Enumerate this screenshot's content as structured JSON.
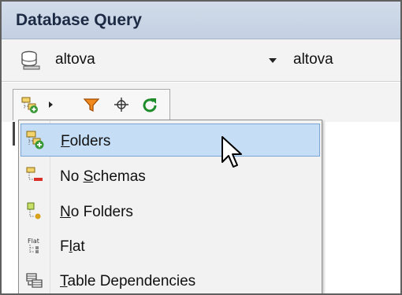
{
  "window": {
    "title": "Database Query"
  },
  "connection": {
    "db_icon": "database-icon",
    "datasource": "altova",
    "schema": "altova"
  },
  "toolbar": {
    "icons": [
      "folders-layout-icon",
      "submenu-arrow-icon",
      "filter-icon",
      "crosshair-locate-icon",
      "refresh-icon"
    ]
  },
  "menu": {
    "items": [
      {
        "label_underline": "F",
        "label_rest": "olders",
        "label_prefix": "",
        "icon": "folders-icon",
        "selected": true
      },
      {
        "label_prefix": "No ",
        "label_underline": "S",
        "label_rest": "chemas",
        "icon": "no-schemas-icon",
        "selected": false
      },
      {
        "label_prefix": "",
        "label_underline": "N",
        "label_rest": "o Folders",
        "icon": "no-folders-icon",
        "selected": false
      },
      {
        "label_prefix": "F",
        "label_underline": "l",
        "label_rest": "at",
        "icon": "flat-icon",
        "selected": false
      },
      {
        "label_prefix": "",
        "label_underline": "T",
        "label_rest": "able Dependencies",
        "icon": "table-dependencies-icon",
        "selected": false
      }
    ]
  },
  "flat_icon_text": "Flat",
  "colors": {
    "title_bar": "#c8d4e6",
    "selection": "#c6def5",
    "selection_border": "#7aa5d6",
    "filter_orange": "#e07a10",
    "refresh_green": "#1e8c2a"
  },
  "cursor": "arrow-pointer-icon"
}
